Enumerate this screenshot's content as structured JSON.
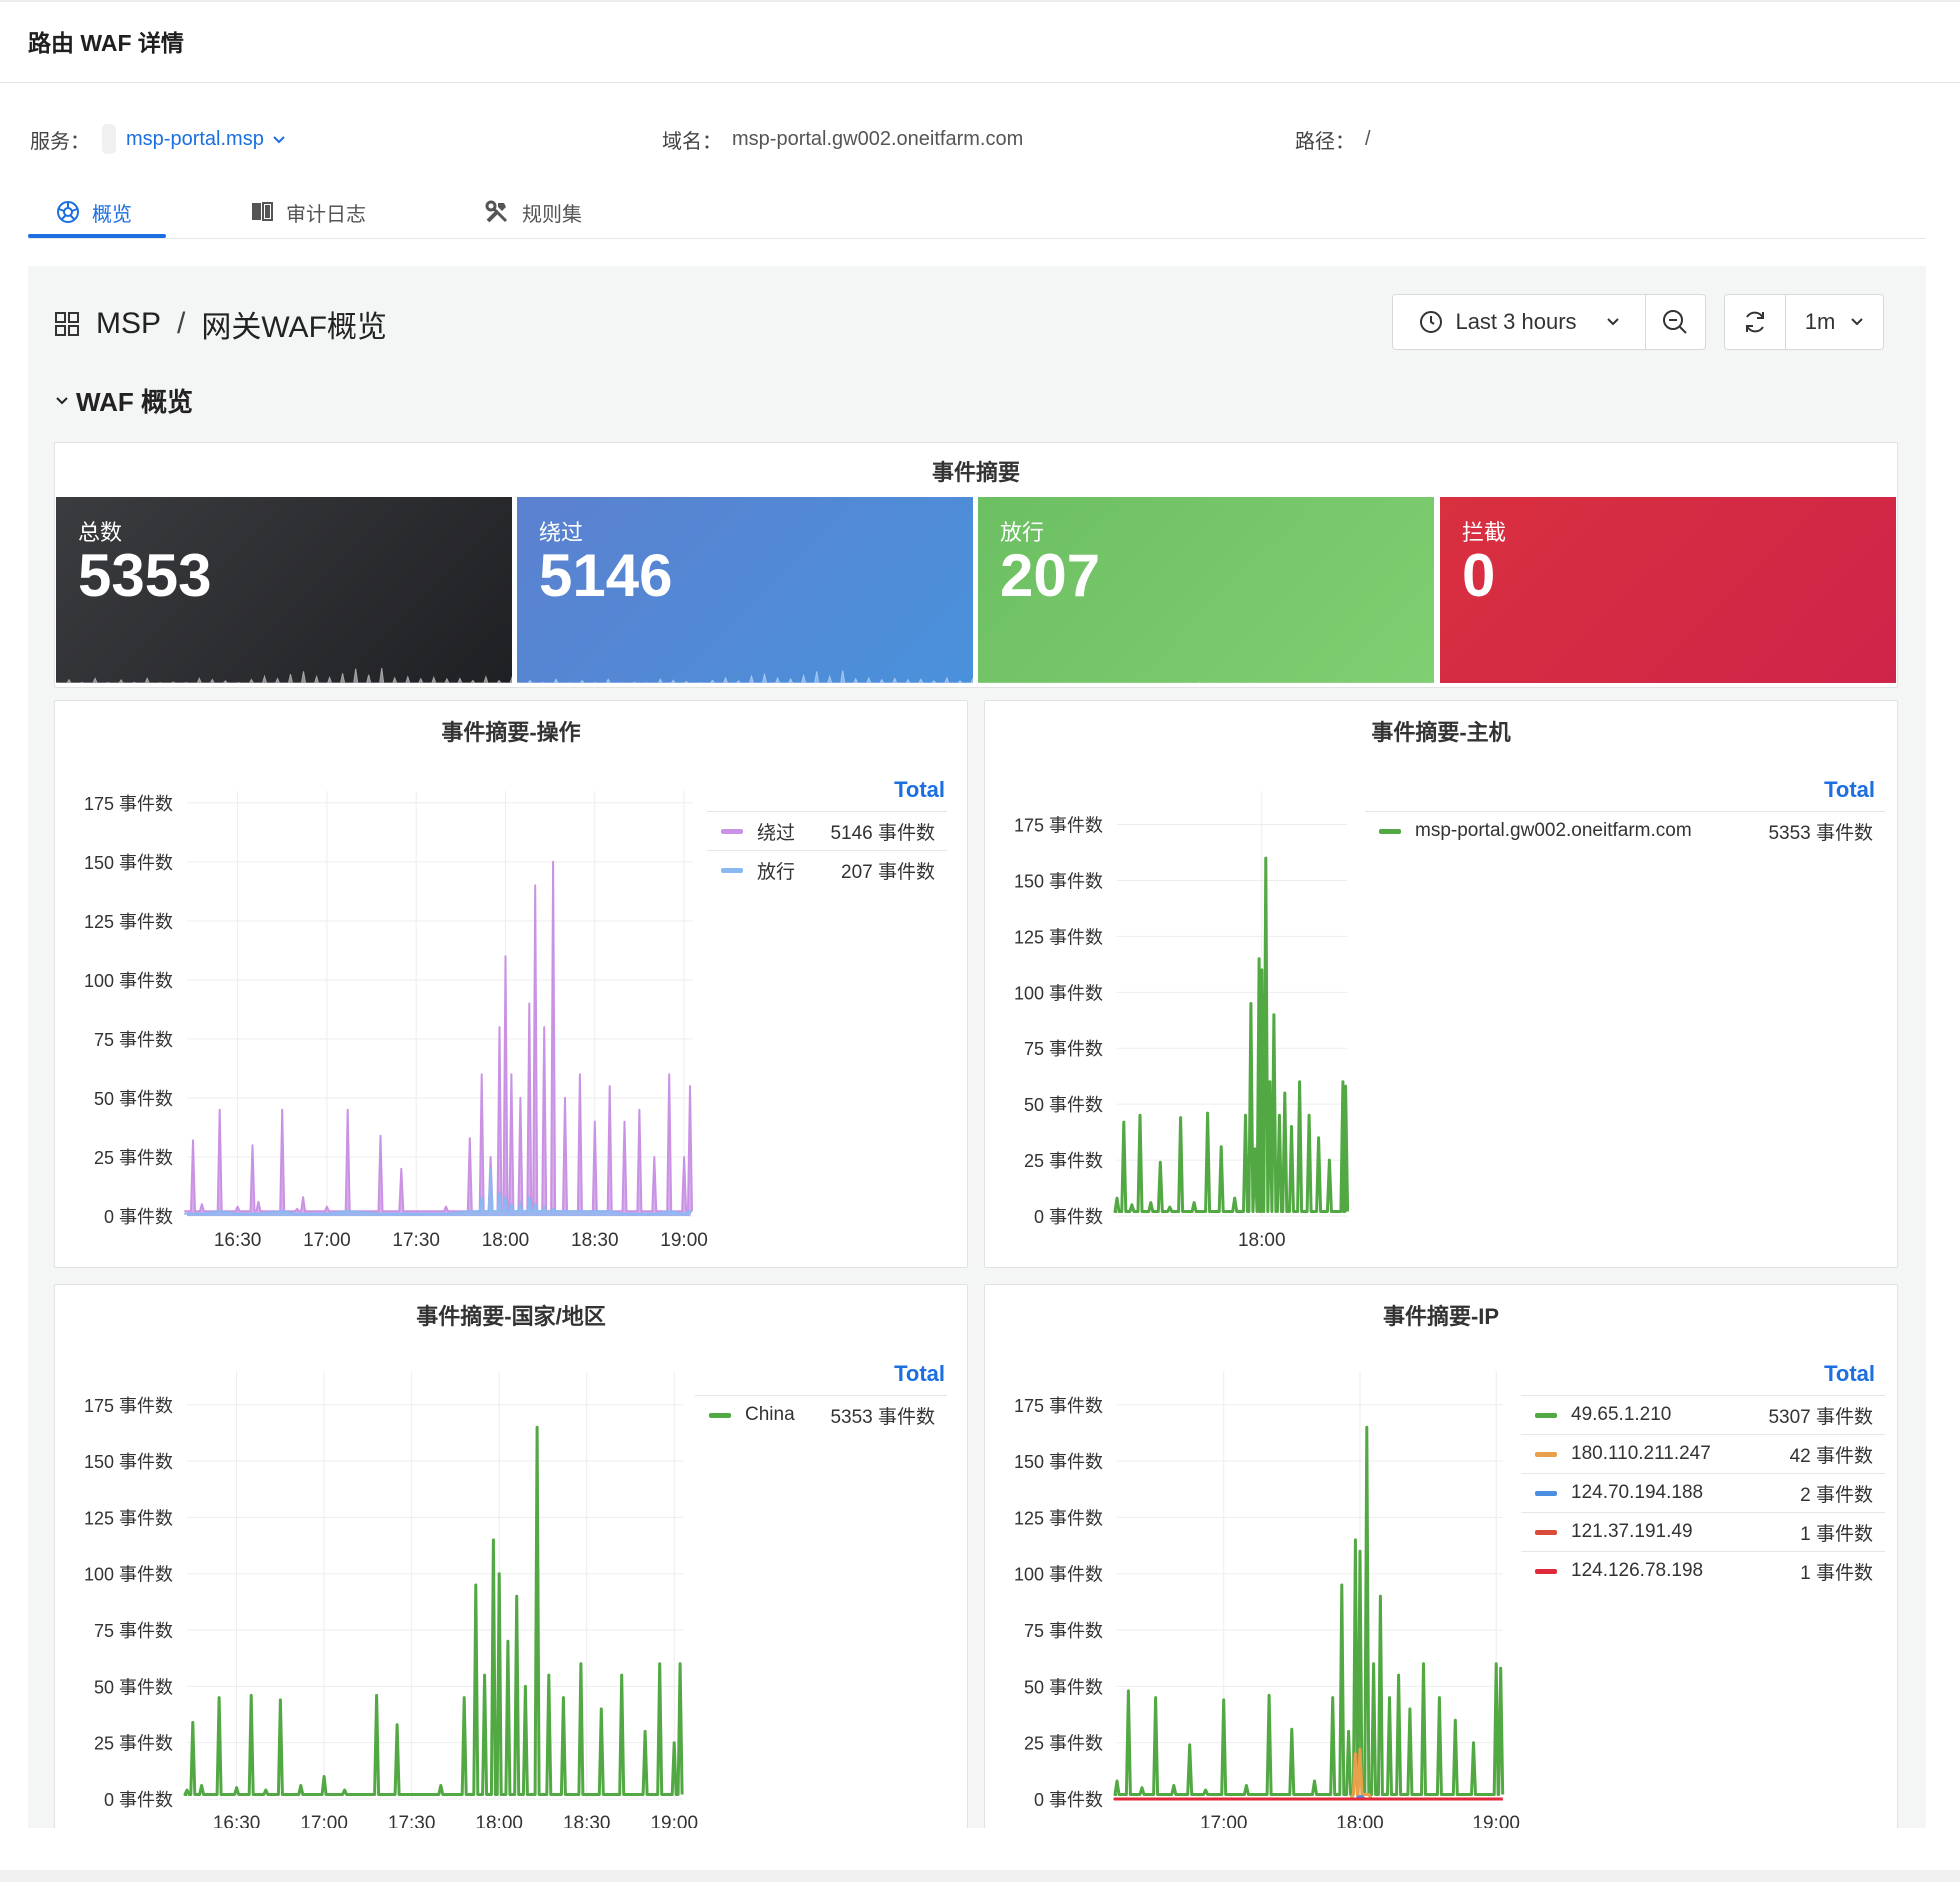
{
  "page": {
    "title": "路由 WAF 详情"
  },
  "info": {
    "service_label": "服务：",
    "service_value": "msp-portal.msp",
    "domain_label": "域名：",
    "domain_value": "msp-portal.gw002.oneitfarm.com",
    "path_label": "路径：",
    "path_value": "/"
  },
  "tabs": [
    {
      "label": "概览",
      "icon": "dashboard-icon",
      "active": true
    },
    {
      "label": "审计日志",
      "icon": "book-icon",
      "active": false
    },
    {
      "label": "规则集",
      "icon": "tools-icon",
      "active": false
    }
  ],
  "dashboard": {
    "breadcrumb": [
      "MSP",
      "网关WAF概览"
    ],
    "time_range": "Last 3 hours",
    "refresh_interval": "1m",
    "row_title": "WAF 概览"
  },
  "summary": {
    "title": "事件摘要",
    "stats": [
      {
        "label": "总数",
        "value": "5353",
        "color": "#2d2e30"
      },
      {
        "label": "绕过",
        "value": "5146",
        "color": "#5784cf"
      },
      {
        "label": "放行",
        "value": "207",
        "color": "#73c36a"
      },
      {
        "label": "拦截",
        "value": "0",
        "color": "#d42f45"
      }
    ]
  },
  "panels": {
    "operation": {
      "title": "事件摘要-操作",
      "legend_header": "Total",
      "legend": [
        {
          "name": "绕过",
          "value": "5146 事件数",
          "color": "#c992e4"
        },
        {
          "name": "放行",
          "value": "207 事件数",
          "color": "#8ab8f0"
        }
      ]
    },
    "host": {
      "title": "事件摘要-主机",
      "legend_header": "Total",
      "legend": [
        {
          "name": "msp-portal.gw002.oneitfarm.com",
          "value": "5353 事件数",
          "color": "#52a843"
        }
      ]
    },
    "country": {
      "title": "事件摘要-国家/地区",
      "legend_header": "Total",
      "legend": [
        {
          "name": "China",
          "value": "5353 事件数",
          "color": "#52a843"
        }
      ]
    },
    "ip": {
      "title": "事件摘要-IP",
      "legend_header": "Total",
      "legend": [
        {
          "name": "49.65.1.210",
          "value": "5307 事件数",
          "color": "#52a843"
        },
        {
          "name": "180.110.211.247",
          "value": "42 事件数",
          "color": "#e8a04a"
        },
        {
          "name": "124.70.194.188",
          "value": "2 事件数",
          "color": "#4a8fe0"
        },
        {
          "name": "121.37.191.49",
          "value": "1 事件数",
          "color": "#d94c3a"
        },
        {
          "name": "124.126.78.198",
          "value": "1 事件数",
          "color": "#e0293a"
        }
      ]
    }
  },
  "chart_data": [
    {
      "type": "line",
      "title": "事件摘要-操作",
      "x_ticks": [
        "16:30",
        "17:00",
        "17:30",
        "18:00",
        "18:30",
        "19:00"
      ],
      "y_ticks": [
        "0 事件数",
        "25 事件数",
        "50 事件数",
        "75 事件数",
        "100 事件数",
        "125 事件数",
        "150 事件数",
        "175 事件数"
      ],
      "ylim": [
        0,
        180
      ],
      "x": [
        "16:13",
        "16:15",
        "16:18",
        "16:24",
        "16:30",
        "16:35",
        "16:37",
        "16:45",
        "16:50",
        "16:52",
        "17:00",
        "17:07",
        "17:18",
        "17:25",
        "17:40",
        "17:48",
        "17:52",
        "17:55",
        "17:58",
        "18:00",
        "18:02",
        "18:05",
        "18:08",
        "18:10",
        "18:13",
        "18:16",
        "18:20",
        "18:25",
        "18:30",
        "18:35",
        "18:40",
        "18:45",
        "18:50",
        "18:55",
        "19:00",
        "19:02"
      ],
      "series": [
        {
          "name": "绕过",
          "values": [
            2,
            32,
            5,
            45,
            4,
            30,
            6,
            45,
            3,
            8,
            4,
            45,
            34,
            20,
            4,
            33,
            60,
            25,
            80,
            110,
            60,
            50,
            90,
            140,
            80,
            150,
            50,
            60,
            40,
            55,
            40,
            45,
            25,
            60,
            25,
            55
          ]
        },
        {
          "name": "放行",
          "values": [
            1,
            1,
            1,
            2,
            1,
            1,
            1,
            2,
            1,
            1,
            1,
            2,
            1,
            1,
            1,
            2,
            8,
            20,
            10,
            8,
            5,
            6,
            8,
            5,
            4,
            3,
            2,
            2,
            2,
            2,
            1,
            1,
            1,
            2,
            1,
            2
          ]
        }
      ]
    },
    {
      "type": "line",
      "title": "事件摘要-主机",
      "x_ticks": [
        "18:00"
      ],
      "y_ticks": [
        "0 事件数",
        "25 事件数",
        "50 事件数",
        "75 事件数",
        "100 事件数",
        "125 事件数",
        "150 事件数",
        "175 事件数"
      ],
      "ylim": [
        0,
        190
      ],
      "x": [
        "16:13",
        "16:18",
        "16:24",
        "16:30",
        "16:38",
        "16:45",
        "16:52",
        "17:00",
        "17:10",
        "17:20",
        "17:30",
        "17:40",
        "17:48",
        "17:52",
        "17:55",
        "17:58",
        "18:00",
        "18:03",
        "18:06",
        "18:09",
        "18:13",
        "18:17",
        "18:22",
        "18:28",
        "18:35",
        "18:42",
        "18:50",
        "19:00",
        "19:02"
      ],
      "series": [
        {
          "name": "msp-portal.gw002.oneitfarm.com",
          "values": [
            8,
            42,
            5,
            45,
            6,
            24,
            4,
            44,
            6,
            46,
            31,
            8,
            45,
            95,
            30,
            115,
            110,
            160,
            60,
            90,
            45,
            55,
            40,
            60,
            45,
            35,
            25,
            60,
            58
          ]
        }
      ]
    },
    {
      "type": "line",
      "title": "事件摘要-国家/地区",
      "x_ticks": [
        "16:30",
        "17:00",
        "17:30",
        "18:00",
        "18:30",
        "19:00"
      ],
      "y_ticks": [
        "0 事件数",
        "25 事件数",
        "50 事件数",
        "75 事件数",
        "100 事件数",
        "125 事件数",
        "150 事件数",
        "175 事件数"
      ],
      "ylim": [
        0,
        190
      ],
      "x": [
        "16:13",
        "16:15",
        "16:18",
        "16:24",
        "16:30",
        "16:35",
        "16:40",
        "16:45",
        "16:52",
        "17:00",
        "17:07",
        "17:18",
        "17:25",
        "17:40",
        "17:48",
        "17:52",
        "17:55",
        "17:58",
        "18:00",
        "18:03",
        "18:06",
        "18:09",
        "18:13",
        "18:17",
        "18:22",
        "18:28",
        "18:35",
        "18:42",
        "18:50",
        "18:55",
        "19:00",
        "19:02"
      ],
      "series": [
        {
          "name": "China",
          "values": [
            4,
            34,
            6,
            45,
            5,
            46,
            4,
            44,
            6,
            10,
            4,
            46,
            33,
            6,
            45,
            95,
            55,
            115,
            100,
            70,
            90,
            50,
            165,
            55,
            45,
            60,
            40,
            55,
            30,
            60,
            25,
            60
          ]
        }
      ]
    },
    {
      "type": "line",
      "title": "事件摘要-IP",
      "x_ticks": [
        "17:00",
        "18:00",
        "19:00"
      ],
      "y_ticks": [
        "0 事件数",
        "25 事件数",
        "50 事件数",
        "75 事件数",
        "100 事件数",
        "125 事件数",
        "150 事件数",
        "175 事件数"
      ],
      "ylim": [
        0,
        190
      ],
      "x": [
        "16:13",
        "16:18",
        "16:24",
        "16:30",
        "16:38",
        "16:45",
        "16:52",
        "17:00",
        "17:10",
        "17:20",
        "17:30",
        "17:40",
        "17:48",
        "17:52",
        "17:55",
        "17:58",
        "18:00",
        "18:03",
        "18:06",
        "18:09",
        "18:13",
        "18:17",
        "18:22",
        "18:28",
        "18:35",
        "18:42",
        "18:50",
        "19:00",
        "19:02"
      ],
      "series": [
        {
          "name": "49.65.1.210",
          "values": [
            8,
            48,
            5,
            45,
            6,
            24,
            4,
            44,
            6,
            46,
            31,
            8,
            45,
            95,
            30,
            115,
            110,
            165,
            60,
            90,
            45,
            55,
            40,
            60,
            45,
            35,
            25,
            60,
            58
          ]
        },
        {
          "name": "180.110.211.247",
          "values": [
            0,
            0,
            0,
            0,
            0,
            0,
            0,
            0,
            0,
            0,
            0,
            0,
            0,
            0,
            0,
            20,
            22,
            2,
            0,
            0,
            0,
            0,
            0,
            0,
            0,
            0,
            0,
            0,
            0
          ]
        },
        {
          "name": "124.70.194.188",
          "values": [
            0,
            0,
            0,
            0,
            0,
            0,
            0,
            0,
            0,
            0,
            0,
            0,
            0,
            0,
            0,
            0,
            1,
            0,
            0,
            0,
            0,
            0,
            0,
            0,
            0,
            0,
            0,
            0,
            0
          ]
        },
        {
          "name": "121.37.191.49",
          "values": [
            0,
            0,
            0,
            0,
            0,
            0,
            0,
            0,
            0,
            0,
            0,
            0,
            0,
            0,
            0,
            0,
            0,
            0,
            0,
            0,
            0,
            0,
            0,
            0,
            0,
            0,
            0,
            0,
            0
          ]
        },
        {
          "name": "124.126.78.198",
          "values": [
            0,
            0,
            0,
            0,
            0,
            0,
            0,
            0,
            0,
            0,
            0,
            0,
            0,
            0,
            0,
            0,
            0,
            0,
            0,
            0,
            0,
            0,
            0,
            0,
            0,
            0,
            0,
            0,
            0
          ]
        }
      ]
    }
  ]
}
